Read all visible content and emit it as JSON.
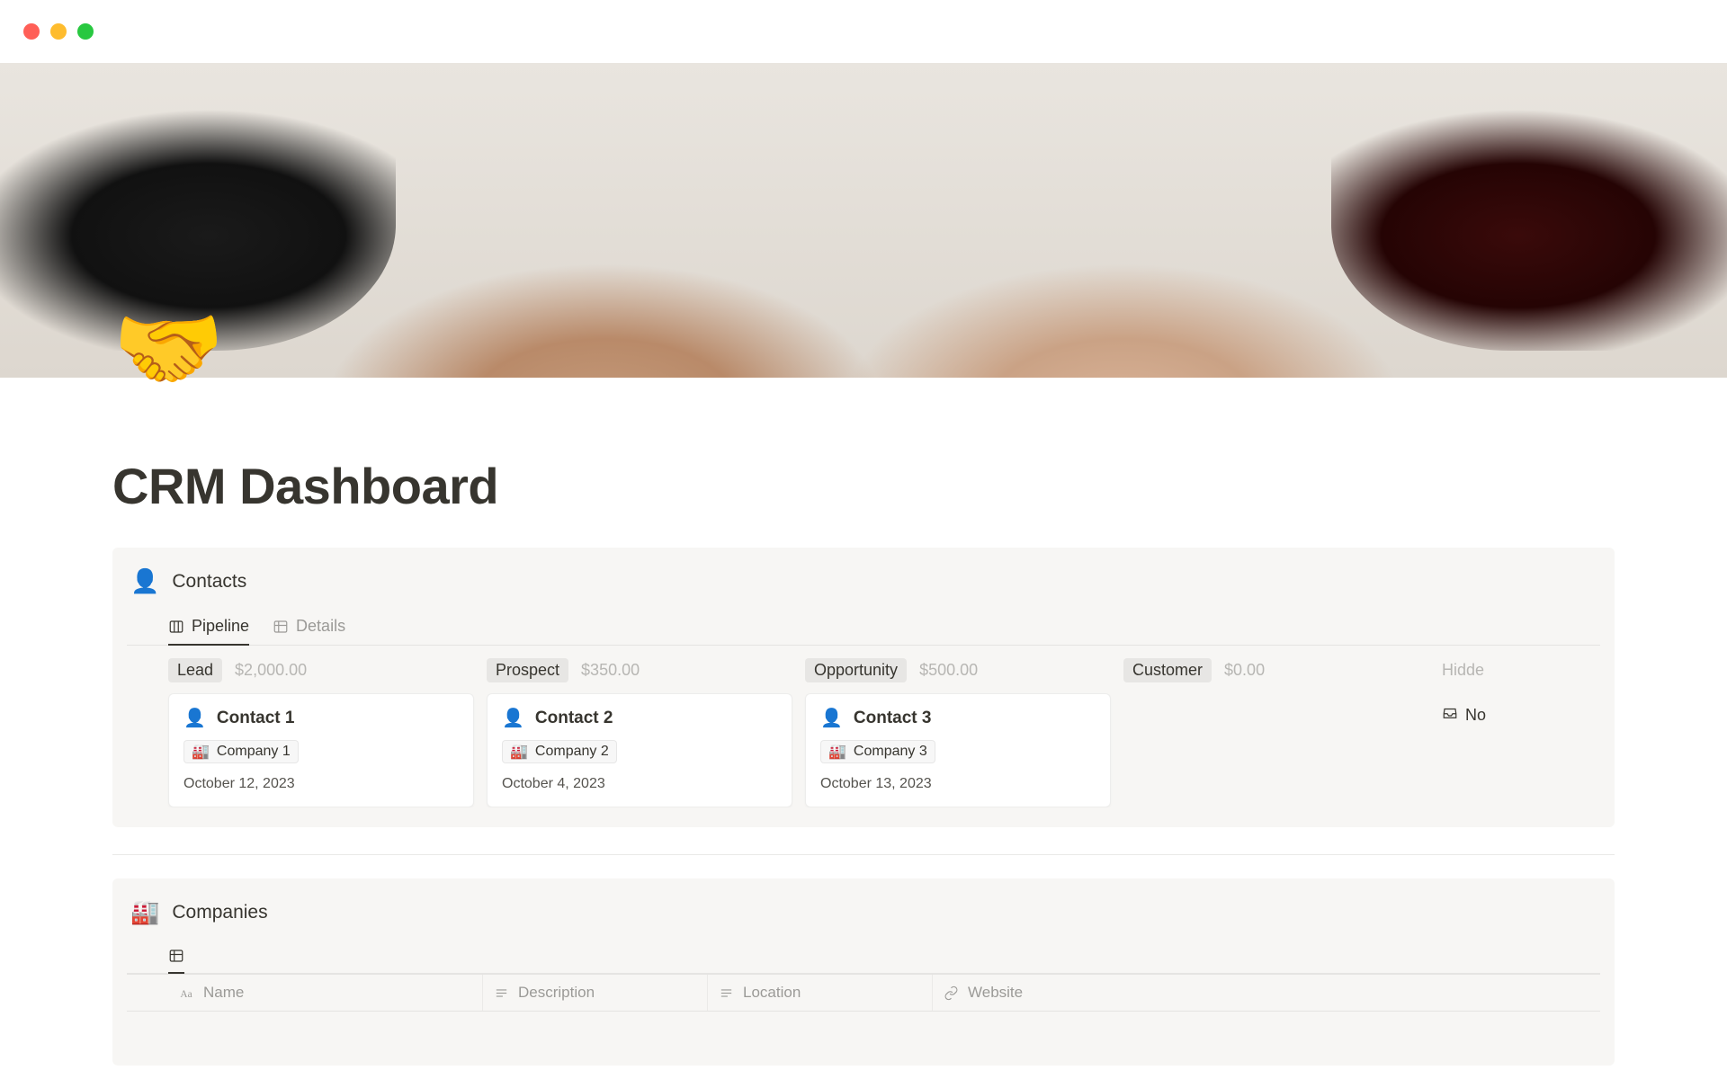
{
  "page": {
    "icon": "🤝",
    "title": "CRM Dashboard"
  },
  "contacts": {
    "icon": "👤",
    "title": "Contacts",
    "tabs": [
      {
        "label": "Pipeline",
        "active": true
      },
      {
        "label": "Details",
        "active": false
      }
    ],
    "columns": [
      {
        "stage": "Lead",
        "amount": "$2,000.00",
        "card": {
          "title": "Contact 1",
          "company": "Company 1",
          "date": "October 12, 2023"
        }
      },
      {
        "stage": "Prospect",
        "amount": "$350.00",
        "card": {
          "title": "Contact 2",
          "company": "Company 2",
          "date": "October 4, 2023"
        }
      },
      {
        "stage": "Opportunity",
        "amount": "$500.00",
        "card": {
          "title": "Contact 3",
          "company": "Company 3",
          "date": "October 13, 2023"
        }
      },
      {
        "stage": "Customer",
        "amount": "$0.00",
        "card": null
      }
    ],
    "hidden_label": "Hidde",
    "hidden_row": "No"
  },
  "companies": {
    "icon": "🏭",
    "title": "Companies",
    "columns": [
      {
        "label": "Name"
      },
      {
        "label": "Description"
      },
      {
        "label": "Location"
      },
      {
        "label": "Website"
      }
    ]
  }
}
